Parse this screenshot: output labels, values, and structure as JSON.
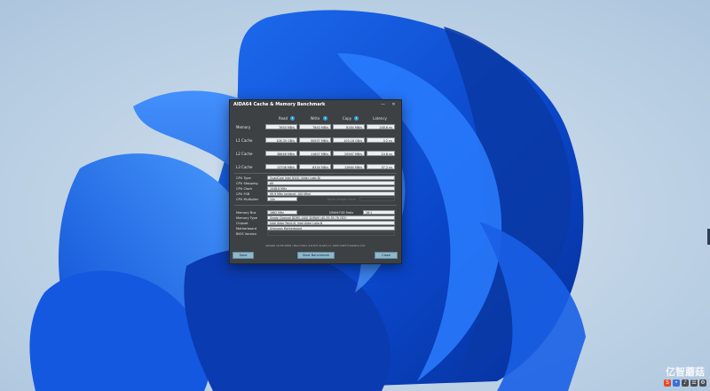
{
  "window": {
    "title": "AIDA64 Cache & Memory Benchmark",
    "minimize": "—",
    "close": "✕"
  },
  "columns": [
    "Read",
    "Write",
    "Copy",
    "Latency"
  ],
  "rows": [
    {
      "label": "Memory",
      "read": "7650 MB/s",
      "write": "7643 MB/s",
      "copy": "8164 MB/s",
      "latency": "148.6 ns"
    },
    {
      "label": "L1 Cache",
      "read": "108.35 GB/s",
      "write": "50937 MB/s",
      "copy": "103.16 GB/s",
      "latency": "3.2 ns"
    },
    {
      "label": "L2 Cache",
      "read": "38648 MB/s",
      "write": "11607 MB/s",
      "copy": "20567 MB/s",
      "latency": "10.8 ns"
    },
    {
      "label": "L3 Cache",
      "read": "13708 MB/s",
      "write": "8334 MB/s",
      "copy": "12664 MB/s",
      "latency": "37.2 ns"
    }
  ],
  "cpu": [
    {
      "label": "CPU Type",
      "value": "QuadCore Intel N100  (Alder Lake-N)"
    },
    {
      "label": "CPU Stepping",
      "value": "A0"
    },
    {
      "label": "CPU Clock",
      "value": "1048.6 MHz"
    },
    {
      "label": "CPU FSB",
      "value": "99.9 MHz  (original: 100 MHz)"
    },
    {
      "label": "CPU Multiplier",
      "value": "10x",
      "extra_label": "North Bridge Clock"
    }
  ],
  "memory": [
    {
      "label": "Memory Bus",
      "value": "1662 MHz",
      "extra_label": "DRAM:FSB Ratio",
      "extra_value": "16:1"
    },
    {
      "label": "Memory Type",
      "value": "Single Channel DDR5-1400 SDRAM  (40-39-39-76 CR2)"
    },
    {
      "label": "Chipset",
      "value": "Intel Alder Point-N, Intel Alder Lake-N"
    },
    {
      "label": "Motherboard",
      "value": "Unknown Motherboard"
    },
    {
      "label": "BIOS Version",
      "value": ""
    }
  ],
  "footer_note": "AIDA64 v6.85.6300 / BenchDLL 4.6.871.8-x64  (c) 1995-2023 FinalWire Ltd.",
  "buttons": {
    "save": "Save",
    "start": "Start Benchmark",
    "close": "Close"
  },
  "watermark": "亿智蘑菇",
  "colors": {
    "dialog_bg": "#3d4144",
    "button_bg": "#8fb7cc",
    "info_icon": "#2fa5d8"
  }
}
